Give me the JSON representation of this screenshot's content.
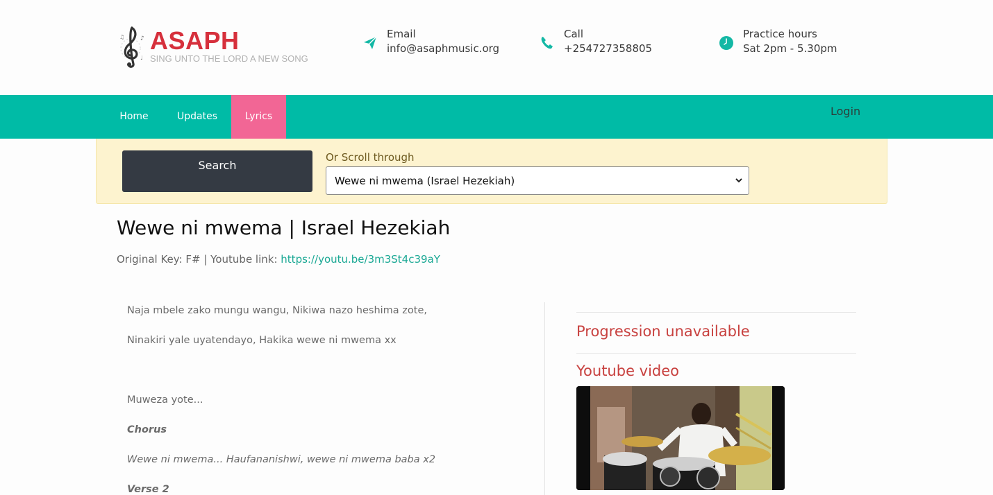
{
  "brand": {
    "name": "ASAPH",
    "tagline": "SING UNTO THE LORD A NEW SONG"
  },
  "contacts": {
    "email": {
      "label": "Email",
      "value": "info@asaphmusic.org",
      "icon": "paper-plane-icon"
    },
    "call": {
      "label": "Call",
      "value": "+254727358805",
      "icon": "phone-icon"
    },
    "hours": {
      "label": "Practice hours",
      "value": "Sat 2pm - 5.30pm",
      "icon": "clock-icon"
    }
  },
  "nav": {
    "home": "Home",
    "updates": "Updates",
    "lyrics": "Lyrics",
    "login": "Login",
    "active": "Lyrics"
  },
  "search": {
    "button_label": "Search",
    "scroll_label": "Or Scroll through",
    "selected_song": "Wewe ni mwema (Israel Hezekiah)"
  },
  "song": {
    "title": "Wewe ni mwema | Israel Hezekiah",
    "meta_prefix": "Original Key: F# | Youtube link: ",
    "youtube_link": "https://youtu.be/3m3St4c39aY"
  },
  "lyrics": {
    "line1": "Naja mbele zako mungu wangu, Nikiwa nazo heshima zote,",
    "line2": "Ninakiri yale uyatendayo, Hakika wewe ni mwema xx",
    "line3": "Muweza yote...",
    "chorus_heading": "Chorus",
    "chorus_line": "Wewe ni mwema... Haufananishwi, wewe ni mwema baba x2",
    "verse2_heading": "Verse 2"
  },
  "sidebar": {
    "progression": "Progression unavailable",
    "youtube_heading": "Youtube video"
  },
  "colors": {
    "brand_red": "#d6303c",
    "nav_teal": "#00bba6",
    "active_pink": "#f26695",
    "panel_yellow": "#fdf3cf",
    "search_dark": "#343a43",
    "link_teal": "#1aa894",
    "accent_red": "#c8413f"
  }
}
